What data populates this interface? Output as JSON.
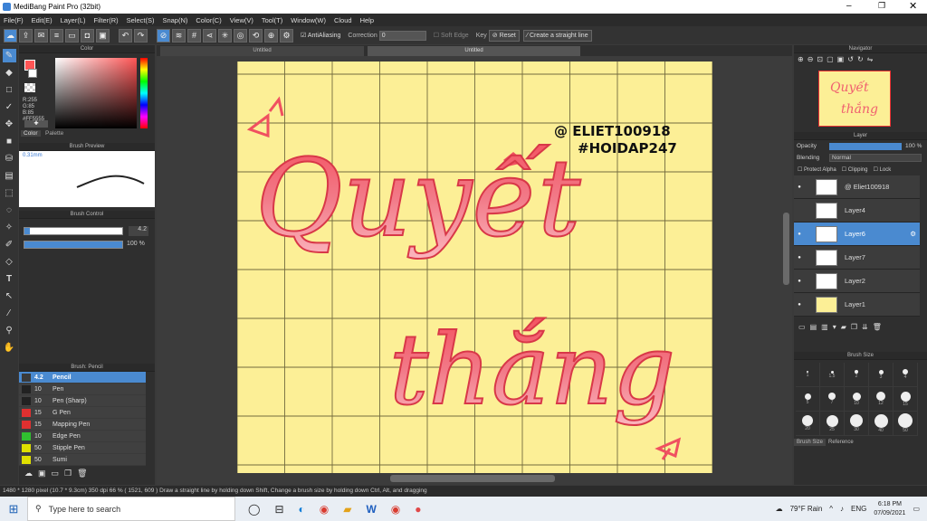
{
  "window": {
    "title": "MediBang Paint Pro (32bit)"
  },
  "menu": [
    "File(F)",
    "Edit(E)",
    "Layer(L)",
    "Filter(R)",
    "Select(S)",
    "Snap(N)",
    "Color(C)",
    "View(V)",
    "Tool(T)",
    "Window(W)",
    "Cloud",
    "Help"
  ],
  "toolbar": {
    "antialias_label": "AntiAliasing",
    "correction_label": "Correction",
    "correction_value": "0",
    "soft_edge_label": "Soft Edge",
    "key_label": "Key",
    "reset_label": "Reset",
    "straight_line_label": "Create a straight line"
  },
  "tabs": {
    "left": "Untitled",
    "center": "Untitled"
  },
  "color_panel": {
    "title": "Color",
    "r": "R:255",
    "g": "G:85",
    "b": "B:85",
    "hex": "#FF5555",
    "tab_color": "Color",
    "tab_palette": "Palette",
    "fg": "#ff5555"
  },
  "brush_preview": {
    "title": "Brush Preview",
    "size": "0.31mm"
  },
  "brush_control": {
    "title": "Brush Control",
    "size": "4.2",
    "opacity": "100 %"
  },
  "brush_list": {
    "title": "Brush: Pencil",
    "items": [
      {
        "size": "4.2",
        "name": "Pencil",
        "color": "#3a3a3a",
        "selected": true
      },
      {
        "size": "10",
        "name": "Pen",
        "color": "#222222",
        "selected": false
      },
      {
        "size": "10",
        "name": "Pen (Sharp)",
        "color": "#222222",
        "selected": false
      },
      {
        "size": "15",
        "name": "G Pen",
        "color": "#e03030",
        "selected": false
      },
      {
        "size": "15",
        "name": "Mapping Pen",
        "color": "#e03030",
        "selected": false
      },
      {
        "size": "10",
        "name": "Edge Pen",
        "color": "#30c030",
        "selected": false
      },
      {
        "size": "50",
        "name": "Stipple Pen",
        "color": "#e0e000",
        "selected": false
      },
      {
        "size": "50",
        "name": "Sumi",
        "color": "#e0e000",
        "selected": false
      }
    ]
  },
  "artwork": {
    "watermark1": "@ ELIET100918",
    "watermark2": "#HOIDAP247",
    "word1": "Quyết",
    "word2": "thắng",
    "bg": "#fcef96",
    "ink": "#f06070"
  },
  "navigator": {
    "title": "Navigator"
  },
  "layer_panel": {
    "title": "Layer",
    "opacity_label": "Opacity",
    "opacity_value": "100 %",
    "blending_label": "Blending",
    "blending_value": "Normal",
    "protect_alpha": "Protect Alpha",
    "clipping": "Clipping",
    "lock": "Lock",
    "layers": [
      {
        "name": "@ Eliet100918",
        "selected": false,
        "visible": true
      },
      {
        "name": "Layer4",
        "selected": false,
        "visible": false
      },
      {
        "name": "Layer6",
        "selected": true,
        "visible": true
      },
      {
        "name": "Layer7",
        "selected": false,
        "visible": true
      },
      {
        "name": "Layer2",
        "selected": false,
        "visible": true
      },
      {
        "name": "Layer1",
        "selected": false,
        "visible": true
      }
    ]
  },
  "brush_size_panel": {
    "title": "Brush Size",
    "sizes": [
      "1",
      "1.5",
      "2",
      "3",
      "4",
      "5",
      "7",
      "10",
      "12",
      "15",
      "20",
      "25",
      "30",
      "40",
      "50"
    ],
    "tab1": "Brush Size",
    "tab2": "Reference"
  },
  "status": "1480 * 1280 pixel  (10.7 * 9.3cm)  350 dpi  66 %  ( 1521, 609 )  Draw a straight line by holding down Shift, Change a brush size by holding down Ctrl, Alt, and dragging",
  "taskbar": {
    "search_placeholder": "Type here to search",
    "weather": "79°F  Rain",
    "lang": "ENG",
    "time": "6:18 PM",
    "date": "07/09/2021"
  }
}
